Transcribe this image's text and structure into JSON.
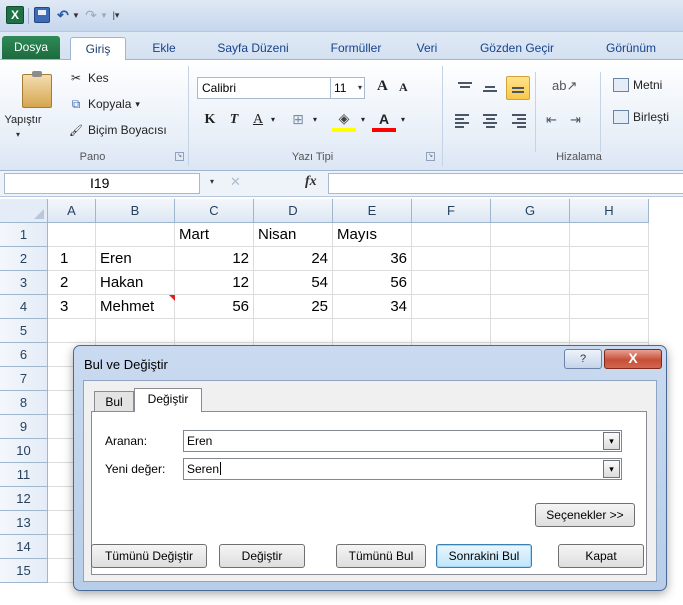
{
  "app": {
    "logo": "X"
  },
  "quick_access": {
    "undo_icon": "↶",
    "redo_icon": "↷",
    "dropdown_icon": "▼",
    "customize_icon": "|▾"
  },
  "ribbon_tabs": [
    "Dosya",
    "Giriş",
    "Ekle",
    "Sayfa Düzeni",
    "Formüller",
    "Veri",
    "Gözden Geçir",
    "Görünüm"
  ],
  "clipboard": {
    "paste_label": "Yapıştır",
    "cut_label": "Kes",
    "copy_label": "Kopyala",
    "painter_label": "Biçim Boyacısı",
    "group_label": "Pano",
    "cut_icon": "✂",
    "copy_icon": "⧉",
    "painter_icon": "🖌",
    "dropdown_icon": "▾"
  },
  "font": {
    "name": "Calibri",
    "size": "11",
    "grow": "A",
    "shrink": "A",
    "bold": "K",
    "italic": "T",
    "underline": "A",
    "border_icon": "⊞",
    "fill_icon": "◈",
    "font_color": "A",
    "fill_color": "#ffff00",
    "font_color_value": "#ff0000",
    "group_label": "Yazı Tipi",
    "dropdown_icon": "▾"
  },
  "alignment": {
    "orientation_icon": "ab↗",
    "indent_dec_icon": "⇤",
    "indent_inc_icon": "⇥",
    "wrap_label": "Metni",
    "merge_label": "Birleşti",
    "group_label": "Hizalama"
  },
  "launcher_icon": "↘",
  "formula_bar": {
    "name_box": "I19",
    "dropdown_icon": "▾",
    "cancel_icon": "✕",
    "fx_label": "fx",
    "formula": ""
  },
  "grid": {
    "columns": [
      "A",
      "B",
      "C",
      "D",
      "E",
      "F",
      "G",
      "H"
    ],
    "rows": [
      "1",
      "2",
      "3",
      "4",
      "5",
      "6",
      "7",
      "8",
      "9",
      "10",
      "11",
      "12",
      "13",
      "14",
      "15"
    ],
    "cells": {
      "C1": "Mart",
      "D1": "Nisan",
      "E1": "Mayıs",
      "A2": "1",
      "B2": "Eren",
      "C2": "12",
      "D2": "24",
      "E2": "36",
      "A3": "2",
      "B3": "Hakan",
      "C3": "12",
      "D3": "54",
      "E3": "56",
      "A4": "3",
      "B4": "Mehmet",
      "C4": "56",
      "D4": "25",
      "E4": "34"
    }
  },
  "dialog": {
    "title": "Bul ve Değiştir",
    "help_icon": "?",
    "close_icon": "X",
    "tabs": {
      "find": "Bul",
      "replace": "Değiştir"
    },
    "find_label": "Aranan:",
    "find_value": "Eren",
    "replace_label": "Yeni değer:",
    "replace_value": "Seren",
    "combo_arrow": "▾",
    "options_button": "Seçenekler >>",
    "replace_all_button": "Tümünü Değiştir",
    "replace_button": "Değiştir",
    "find_all_button": "Tümünü Bul",
    "find_next_button": "Sonrakini Bul",
    "close_button": "Kapat"
  }
}
